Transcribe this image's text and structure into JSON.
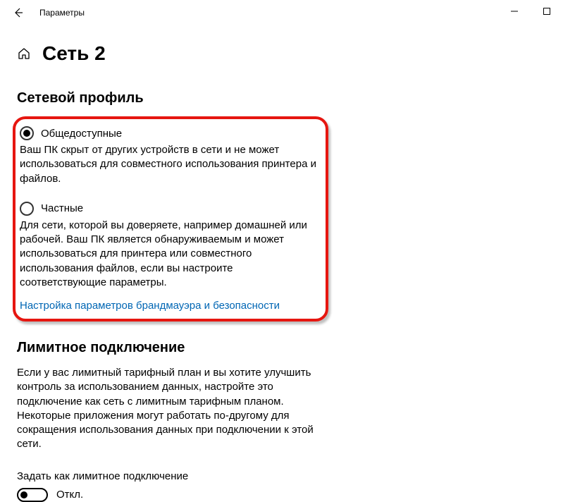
{
  "titlebar": {
    "app_name": "Параметры"
  },
  "header": {
    "page_title": "Сеть 2"
  },
  "profile": {
    "section_title": "Сетевой профиль",
    "public": {
      "label": "Общедоступные",
      "desc": "Ваш ПК скрыт от других устройств в сети и не может использоваться для совместного использования принтера и файлов.",
      "selected": true
    },
    "private": {
      "label": "Частные",
      "desc": "Для сети, которой вы доверяете, например домашней или рабочей. Ваш ПК является обнаруживаемым и может использоваться для принтера или совместного использования файлов, если вы настроите соответствующие параметры.",
      "selected": false
    },
    "firewall_link": "Настройка параметров брандмауэра и безопасности"
  },
  "metered": {
    "section_title": "Лимитное подключение",
    "desc": "Если у вас лимитный тарифный план и вы хотите улучшить контроль за использованием данных, настройте это подключение как сеть с лимитным тарифным планом. Некоторые приложения могут работать по-другому для сокращения использования данных при подключении к этой сети.",
    "toggle_label": "Задать как лимитное подключение",
    "toggle_state": "Откл.",
    "toggle_on": false
  }
}
